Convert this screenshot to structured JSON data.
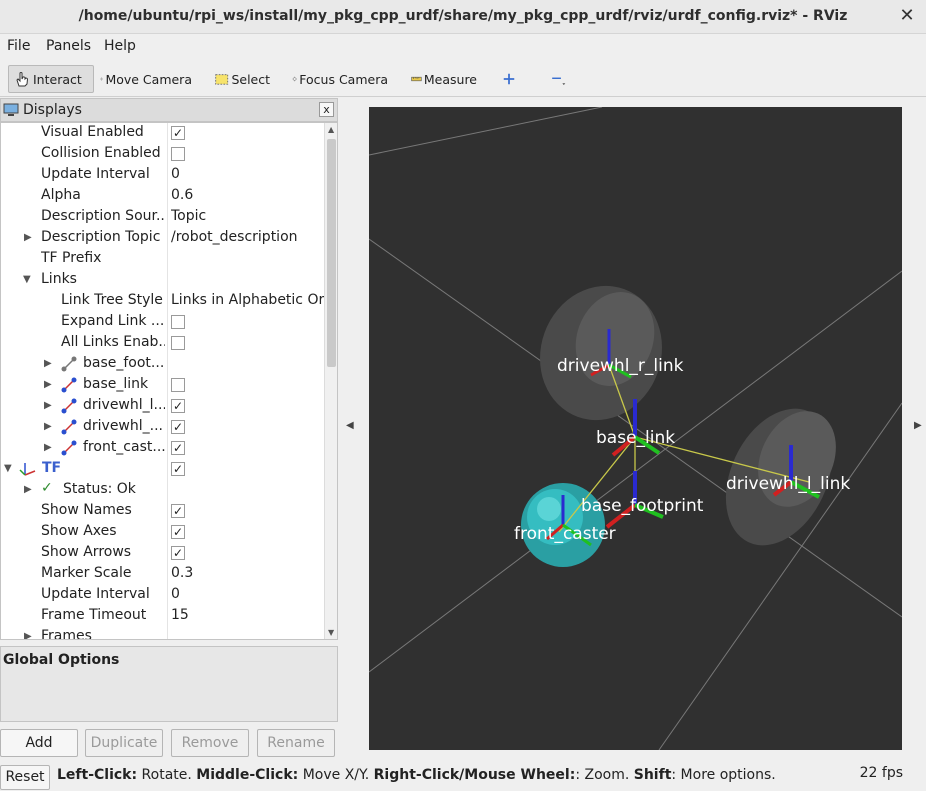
{
  "window": {
    "title": "/home/ubuntu/rpi_ws/install/my_pkg_cpp_urdf/share/my_pkg_cpp_urdf/rviz/urdf_config.rviz* - RViz",
    "close_glyph": "✕"
  },
  "menubar": {
    "file": "File",
    "panels": "Panels",
    "help": "Help"
  },
  "toolbar": {
    "interact": "Interact",
    "move_camera": "Move Camera",
    "select": "Select",
    "focus_camera": "Focus Camera",
    "measure": "Measure",
    "add_tool_icon": "plus-icon",
    "remove_tool_icon": "minus-icon"
  },
  "displays": {
    "title": "Displays",
    "close_glyph": "x",
    "rows": [
      {
        "label": "Visual Enabled",
        "checked": true
      },
      {
        "label": "Collision Enabled",
        "checked": false
      },
      {
        "label": "Update Interval",
        "value": "0"
      },
      {
        "label": "Alpha",
        "value": "0.6"
      },
      {
        "label": "Description Sour...",
        "value": "Topic"
      },
      {
        "label": "Description Topic",
        "value": "/robot_description"
      },
      {
        "label": "TF Prefix",
        "value": ""
      },
      {
        "label": "Links",
        "value": ""
      },
      {
        "label": "Link Tree Style",
        "value": "Links in Alphabetic Or..."
      },
      {
        "label": "Expand Link ...",
        "checked": false
      },
      {
        "label": "All Links Enab...",
        "checked": false
      },
      {
        "label": "base_foot...",
        "value": ""
      },
      {
        "label": "base_link",
        "checked": false
      },
      {
        "label": "drivewhl_l...",
        "checked": true
      },
      {
        "label": "drivewhl_...",
        "checked": true
      },
      {
        "label": "front_cast...",
        "checked": true
      },
      {
        "label": "TF",
        "checked": true
      },
      {
        "label": "Status: Ok",
        "value": ""
      },
      {
        "label": "Show Names",
        "checked": true
      },
      {
        "label": "Show Axes",
        "checked": true
      },
      {
        "label": "Show Arrows",
        "checked": true
      },
      {
        "label": "Marker Scale",
        "value": "0.3"
      },
      {
        "label": "Update Interval",
        "value": "0"
      },
      {
        "label": "Frame Timeout",
        "value": "15"
      },
      {
        "label": "Frames",
        "value": ""
      }
    ]
  },
  "global_options": {
    "title": "Global Options"
  },
  "buttons": {
    "add": "Add",
    "duplicate": "Duplicate",
    "remove": "Remove",
    "rename": "Rename"
  },
  "statusbar": {
    "reset": "Reset",
    "left_click": "Left-Click:",
    "left_click_action": " Rotate. ",
    "middle_click": "Middle-Click:",
    "middle_click_action": " Move X/Y. ",
    "right_click": "Right-Click/Mouse Wheel:",
    "right_click_action": ": Zoom. ",
    "shift": "Shift",
    "shift_action": ": More options.",
    "fps": "22 fps"
  },
  "viewport": {
    "background_color": "#303030",
    "frame_labels": {
      "drivewhl_r": "drivewhl_r_link",
      "base_link": "base_link",
      "drivewhl_l": "drivewhl_l_link",
      "base_footprint": "base_footprint",
      "front_caster": "front_caster"
    }
  },
  "colors": {
    "tf_blue": "#3a5fcd",
    "check_green": "#2e8b2e",
    "caster_cyan": "#2ab3b8"
  }
}
